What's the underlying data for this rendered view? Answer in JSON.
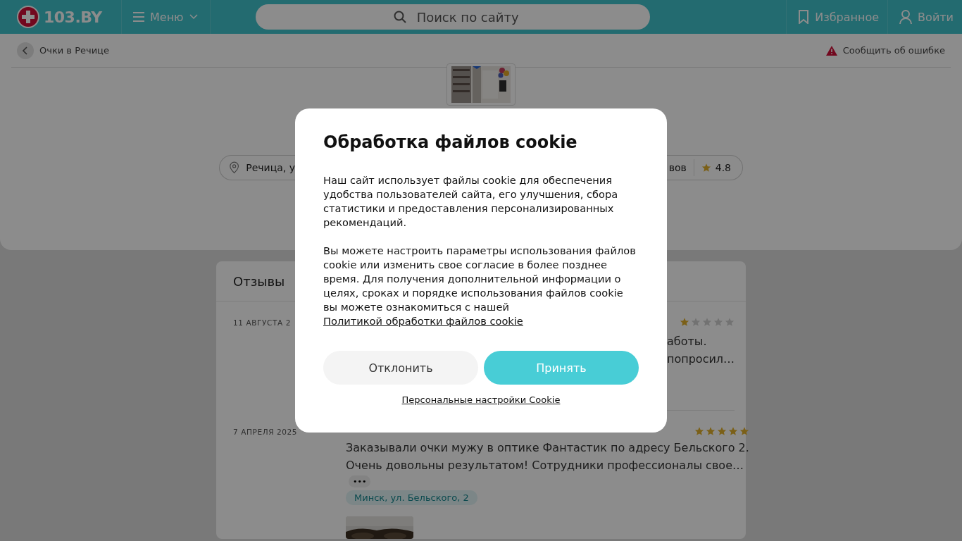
{
  "header": {
    "logo": "103.BY",
    "menu": "Меню",
    "search": {
      "placeholder": "Поиск по сайту"
    },
    "favorites": "Избранное",
    "login": "Войти"
  },
  "breadcrumb": {
    "back": "Очки в Речице",
    "report": "Сообщить об ошибке"
  },
  "business": {
    "photo": true,
    "address": "Речица, у",
    "reviews_count": "вов",
    "rating": "4.8"
  },
  "reviews": {
    "title": "Отзывы",
    "items": [
      {
        "date": "11 АВГУСТА 2",
        "stars": 1,
        "lines": [
          "аботы.",
          "попросил…"
        ]
      },
      {
        "date": "7 АПРЕЛЯ 2025",
        "stars": 5,
        "lines": [
          "Заказывали очки мужу в оптике Фантастик по адресу Бельского 2.",
          "Очень довольны результатом! Сотрудники профессионалы свое…"
        ],
        "more": "•••",
        "tag": "Минск, ул. Бельского, 2",
        "photo": true
      }
    ]
  },
  "cookie": {
    "title": "Обработка файлов cookie",
    "paragraphs": [
      "Наш сайт использует файлы cookie для обеспечения удобства пользователей сайта, его улучшения, сбора статистики и предоставления персонализированных рекомендаций.",
      "Вы можете настроить параметры использования файлов cookie или изменить свое согласие в более позднее время. Для получения дополнительной информации о целях, сроках и порядке использования файлов cookie вы можете ознакомиться с нашей"
    ],
    "policy_link": "Политикой обработки файлов cookie",
    "decline": "Отклонить",
    "accept": "Принять",
    "settings_link": "Персональные настройки Cookie"
  }
}
